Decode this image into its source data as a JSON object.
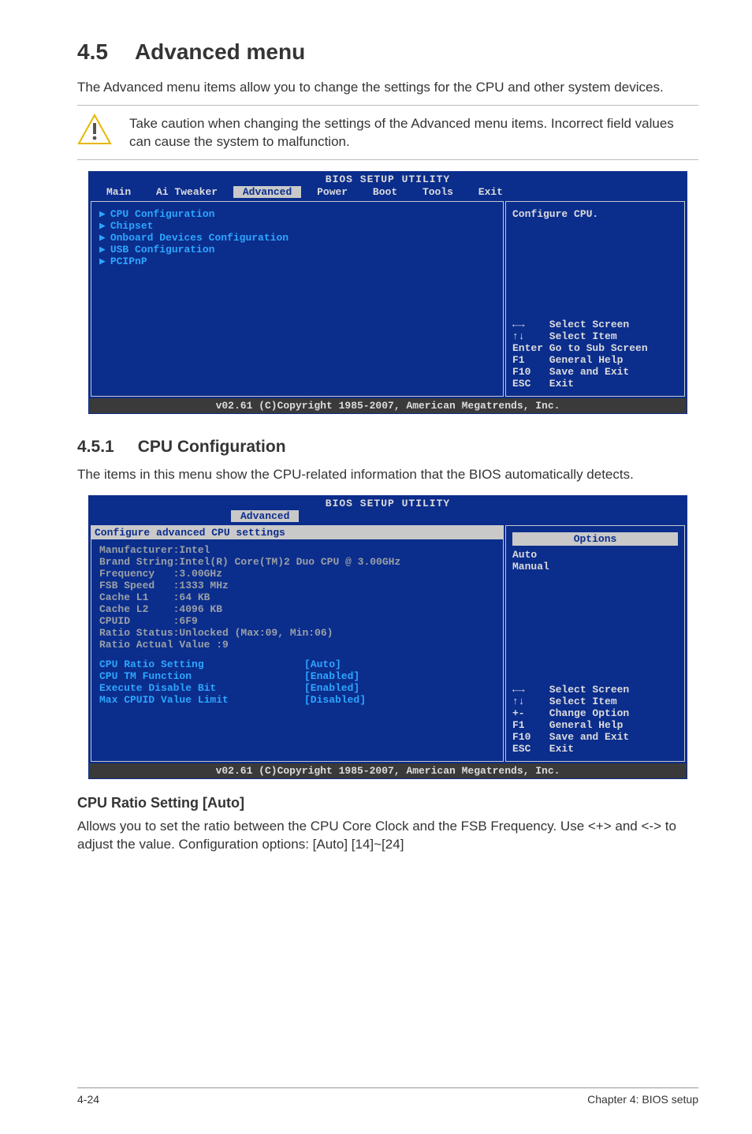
{
  "section": {
    "number": "4.5",
    "title": "Advanced menu"
  },
  "intro": "The Advanced menu items allow you to change the settings for the CPU and other system devices.",
  "caution": "Take caution when changing the settings of the Advanced menu items. Incorrect field values can cause the system to malfunction.",
  "bios_common": {
    "title": "BIOS SETUP UTILITY",
    "footer": "v02.61 (C)Copyright 1985-2007, American Megatrends, Inc."
  },
  "bios1": {
    "tabs": [
      "Main",
      "Ai Tweaker",
      "Advanced",
      "Power",
      "Boot",
      "Tools",
      "Exit"
    ],
    "active_tab": "Advanced",
    "menu_items": [
      "CPU Configuration",
      "Chipset",
      "Onboard Devices Configuration",
      "USB Configuration",
      "PCIPnP"
    ],
    "right_top": "Configure CPU.",
    "help": [
      "←→    Select Screen",
      "↑↓    Select Item",
      "Enter Go to Sub Screen",
      "F1    General Help",
      "F10   Save and Exit",
      "ESC   Exit"
    ]
  },
  "sub": {
    "number": "4.5.1",
    "title": "CPU Configuration"
  },
  "sub_intro": "The items in this menu show the CPU-related information that the BIOS automatically detects.",
  "bios2": {
    "active_tab": "Advanced",
    "panel_title": "Configure advanced CPU settings",
    "info_lines": [
      "Manufacturer:Intel",
      "Brand String:Intel(R) Core(TM)2 Duo CPU @ 3.00GHz",
      "Frequency   :3.00GHz",
      "FSB Speed   :1333 MHz",
      "Cache L1    :64 KB",
      "Cache L2    :4096 KB",
      "CPUID       :6F9",
      "Ratio Status:Unlocked (Max:09, Min:06)",
      "Ratio Actual Value :9"
    ],
    "settings": [
      {
        "k": "CPU Ratio Setting",
        "v": "[Auto]"
      },
      {
        "k": "CPU TM Function",
        "v": "[Enabled]"
      },
      {
        "k": "Execute Disable Bit",
        "v": "[Enabled]"
      },
      {
        "k": "Max CPUID Value Limit",
        "v": "[Disabled]"
      }
    ],
    "options_header": "Options",
    "options": [
      "Auto",
      "Manual"
    ],
    "help": [
      "←→    Select Screen",
      "↑↓    Select Item",
      "+-    Change Option",
      "F1    General Help",
      "F10   Save and Exit",
      "ESC   Exit"
    ]
  },
  "opt_heading": "CPU Ratio Setting [Auto]",
  "opt_body": "Allows you to set the ratio between the CPU Core Clock and the FSB Frequency. Use <+> and <-> to adjust the value. Configuration options: [Auto] [14]~[24]",
  "footer": {
    "left": "4-24",
    "right": "Chapter 4: BIOS setup"
  }
}
